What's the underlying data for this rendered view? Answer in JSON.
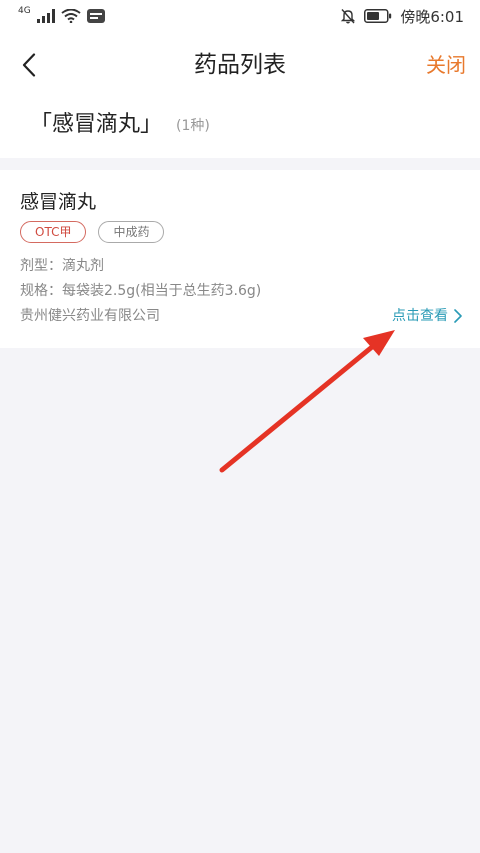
{
  "status_bar": {
    "network": "4G",
    "time": "傍晚6:01"
  },
  "nav": {
    "title": "药品列表",
    "close_label": "关闭"
  },
  "header": {
    "drug_name": "「感冒滴丸」",
    "count": "(1种)"
  },
  "drug_card": {
    "name": "感冒滴丸",
    "tags": [
      "OTC甲",
      "中成药"
    ],
    "dosage_form": "剂型：滴丸剂",
    "spec": "规格：每袋装2.5g(相当于总生药3.6g)",
    "manufacturer": "贵州健兴药业有限公司",
    "view_label": "点击查看"
  },
  "colors": {
    "accent_orange": "#e8792d",
    "link_teal": "#2a9bb6",
    "otc_red": "#d04b40",
    "annotation_arrow": "#e53325"
  }
}
